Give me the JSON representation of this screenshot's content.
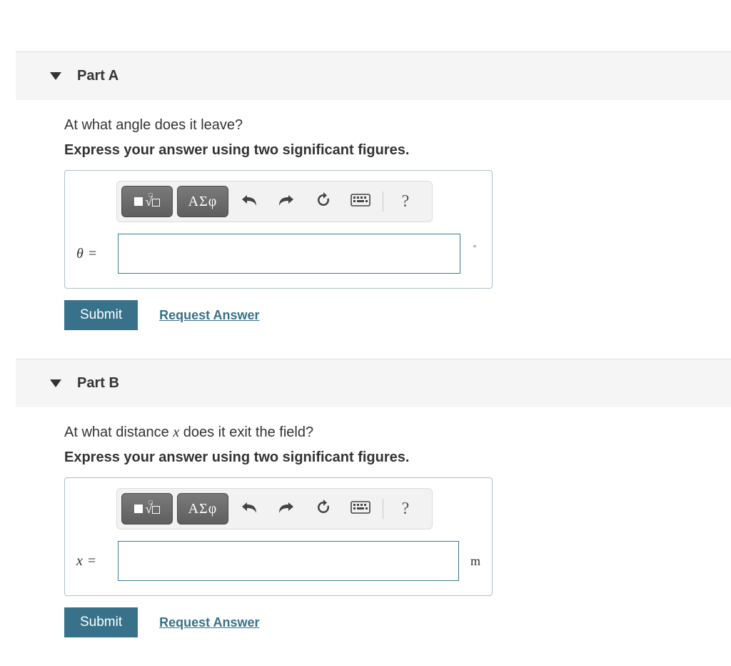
{
  "partA": {
    "header": "Part A",
    "question": "At what angle does it leave?",
    "instruction": "Express your answer using two significant figures.",
    "toolbar": {
      "templates_label": "templates",
      "greek_label": "ΑΣφ",
      "undo_label": "undo",
      "redo_label": "redo",
      "reset_label": "reset",
      "keyboard_label": "keyboard",
      "help_label": "?"
    },
    "variable": "θ",
    "equals": "=",
    "value": "",
    "unit": "°",
    "submit_label": "Submit",
    "request_label": "Request Answer"
  },
  "partB": {
    "header": "Part B",
    "question_pre": "At what distance ",
    "question_var": "x",
    "question_post": " does it exit the field?",
    "instruction": "Express your answer using two significant figures.",
    "toolbar": {
      "templates_label": "templates",
      "greek_label": "ΑΣφ",
      "undo_label": "undo",
      "redo_label": "redo",
      "reset_label": "reset",
      "keyboard_label": "keyboard",
      "help_label": "?"
    },
    "variable": "x",
    "equals": "=",
    "value": "",
    "unit": "m",
    "submit_label": "Submit",
    "request_label": "Request Answer"
  }
}
